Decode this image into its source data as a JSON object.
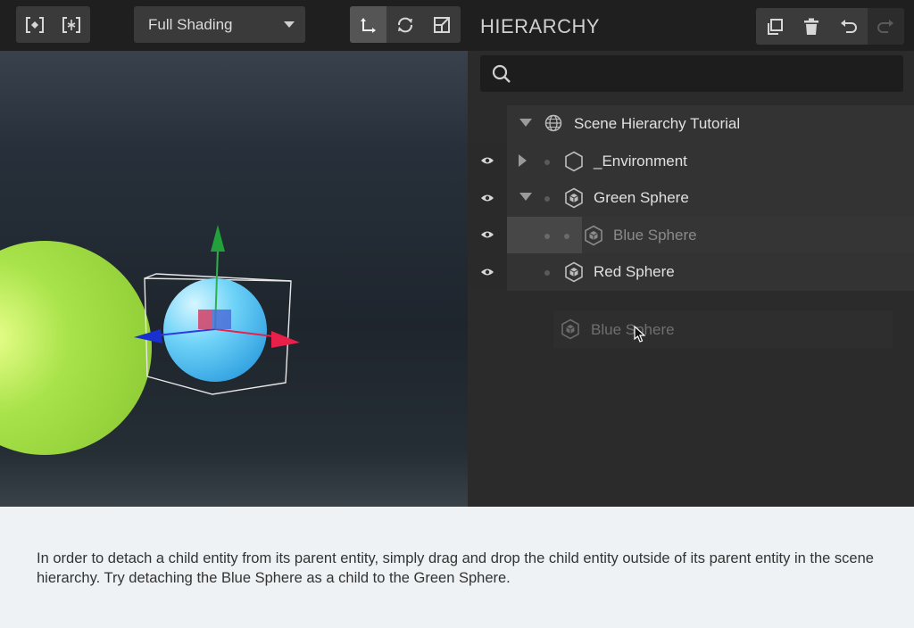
{
  "viewport": {
    "toolbar_left": {
      "icons": [
        "focus-selection-icon",
        "focus-pivot-icon"
      ]
    },
    "shading_mode": {
      "selected": "Full Shading"
    },
    "transform_tools": {
      "icons": [
        "translate-icon",
        "rotate-icon",
        "scale-icon"
      ],
      "active": "translate-icon"
    }
  },
  "hierarchy": {
    "title": "HIERARCHY",
    "actions": {
      "icons": [
        "duplicate-icon",
        "delete-icon",
        "undo-icon",
        "redo-icon"
      ]
    },
    "search": {
      "placeholder": "",
      "value": ""
    },
    "tree": [
      {
        "label": "Scene Hierarchy Tutorial",
        "icon": "globe-icon",
        "expanded": true
      },
      {
        "label": "_Environment",
        "icon": "hexagon-icon",
        "expanded": false
      },
      {
        "label": "Green Sphere",
        "icon": "entity-icon",
        "expanded": true
      },
      {
        "label": "Blue Sphere",
        "icon": "entity-icon",
        "dragging": true
      },
      {
        "label": "Red Sphere",
        "icon": "entity-icon"
      }
    ],
    "drag_ghost": {
      "label": "Blue Sphere"
    }
  },
  "instruction": {
    "text": "In order to detach a child entity from its parent entity, simply drag and drop the child entity outside of its parent entity in the scene hierarchy. Try detaching the Blue Sphere as a child to the Green Sphere."
  },
  "colors": {
    "panel_bg": "#2b2b2b",
    "toolbar_bg": "#1f1f1f",
    "green_sphere": "#a8e04a",
    "blue_sphere": "#5cc8f0",
    "axis_x": "#e8204a",
    "axis_y": "#1f9a3a",
    "axis_z": "#1a2fd0"
  }
}
